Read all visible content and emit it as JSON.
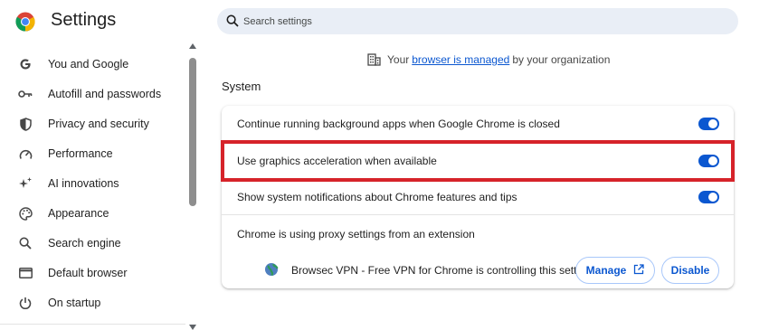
{
  "app": {
    "title": "Settings",
    "logo_icon": "chrome-logo-icon"
  },
  "sidebar": {
    "items": [
      {
        "label": "You and Google",
        "icon": "google-g-icon"
      },
      {
        "label": "Autofill and passwords",
        "icon": "key-icon"
      },
      {
        "label": "Privacy and security",
        "icon": "shield-icon"
      },
      {
        "label": "Performance",
        "icon": "speedometer-icon"
      },
      {
        "label": "AI innovations",
        "icon": "sparkle-icon"
      },
      {
        "label": "Appearance",
        "icon": "palette-icon"
      },
      {
        "label": "Search engine",
        "icon": "search-icon"
      },
      {
        "label": "Default browser",
        "icon": "browser-window-icon"
      },
      {
        "label": "On startup",
        "icon": "power-icon"
      }
    ]
  },
  "search": {
    "placeholder": "Search settings",
    "value": ""
  },
  "managed_notice": {
    "prefix": "Your",
    "link_text": "browser is managed",
    "suffix": "by your organization",
    "icon": "building-icon"
  },
  "section": {
    "title": "System"
  },
  "settings": {
    "rows": [
      {
        "label": "Continue running background apps when Google Chrome is closed",
        "enabled": true
      },
      {
        "label": "Use graphics acceleration when available",
        "enabled": true
      },
      {
        "label": "Show system notifications about Chrome features and tips",
        "enabled": true
      },
      {
        "label": "Chrome is using proxy settings from an extension"
      }
    ],
    "extension": {
      "text": "Browsec VPN - Free VPN for Chrome is controlling this setting",
      "icon": "globe-icon",
      "manage_label": "Manage",
      "manage_icon": "open-in-new-icon",
      "disable_label": "Disable"
    }
  },
  "colors": {
    "accent": "#0b57d0",
    "highlight": "#d6232a",
    "search_bg": "#e9eef6"
  }
}
